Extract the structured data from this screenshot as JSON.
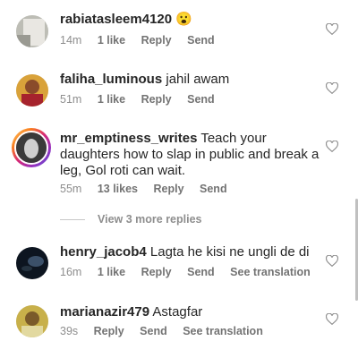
{
  "comments": [
    {
      "username": "rabiatasleem4120",
      "text": "😮",
      "time": "14m",
      "likes": "1 like",
      "reply": "Reply",
      "send": "Send",
      "translate": ""
    },
    {
      "username": "faliha_luminous",
      "text": "jahil awam",
      "time": "51m",
      "likes": "1 like",
      "reply": "Reply",
      "send": "Send",
      "translate": ""
    },
    {
      "username": "mr_emptiness_writes",
      "text": "Teach your daughters how to slap in public and break a leg, Gol roti can wait.",
      "time": "55m",
      "likes": "13 likes",
      "reply": "Reply",
      "send": "Send",
      "translate": ""
    },
    {
      "username": "henry_jacob4",
      "text": "Lagta he kisi ne ungli de di",
      "time": "16m",
      "likes": "1 like",
      "reply": "Reply",
      "send": "Send",
      "translate": "See translation"
    },
    {
      "username": "marianazir479",
      "text": "Astagfar",
      "time": "39s",
      "likes": "",
      "reply": "Reply",
      "send": "Send",
      "translate": "See translation"
    }
  ],
  "view_more": "View 3 more replies",
  "icons": {
    "like": "heart-outline-icon"
  },
  "colors": {
    "text": "#262626",
    "meta": "#8e8e8e"
  }
}
